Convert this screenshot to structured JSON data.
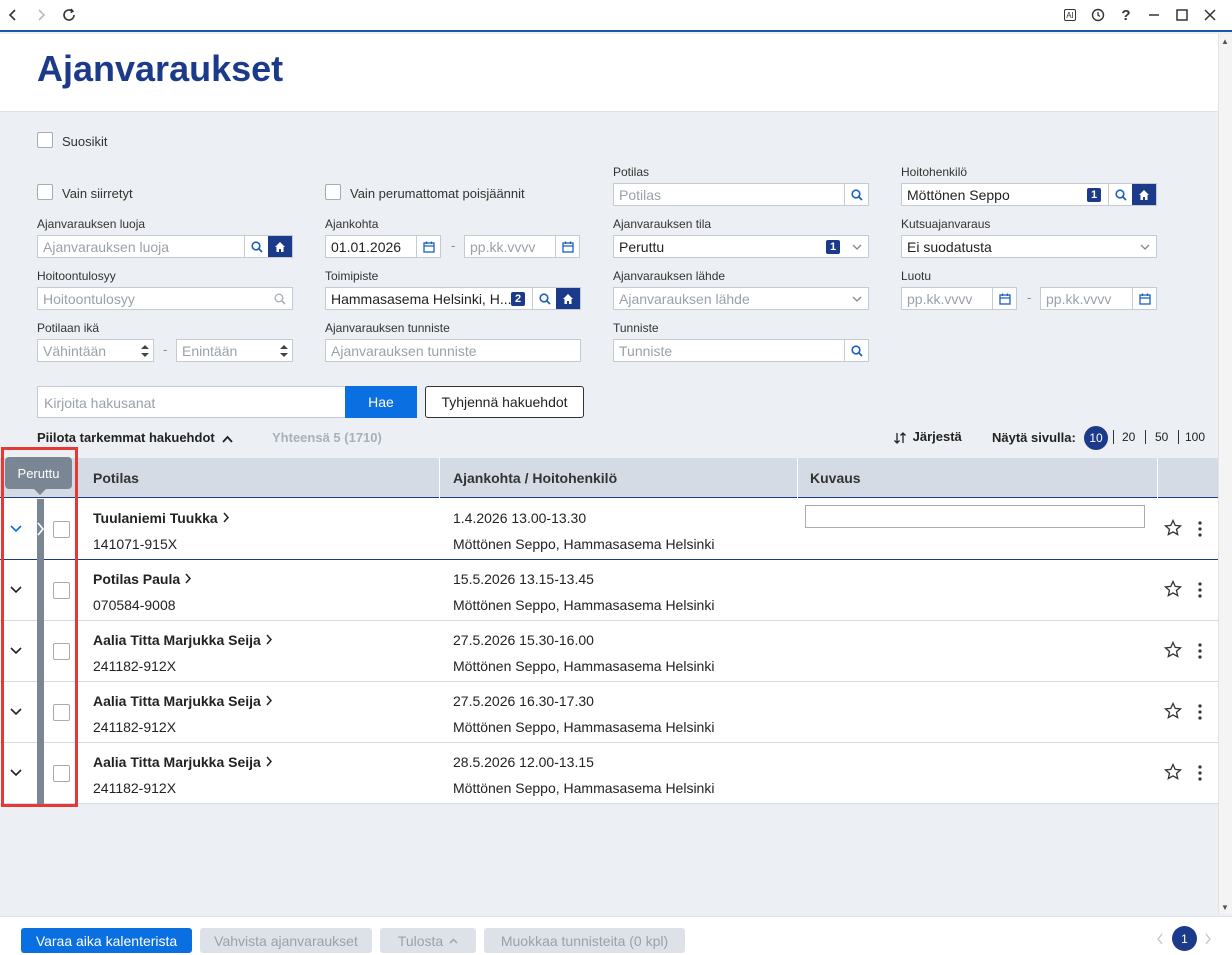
{
  "titlebar": {
    "ai_label": "AI",
    "help": "?"
  },
  "header": {
    "title": "Ajanvaraukset"
  },
  "filters": {
    "favorites_label": "Suosikit",
    "only_moved_label": "Vain siirretyt",
    "only_uncancelled_label": "Vain perumattomat poisjäännit",
    "patient": {
      "label": "Potilas",
      "placeholder": "Potilas"
    },
    "staff": {
      "label": "Hoitohenkilö",
      "value": "Möttönen Seppo",
      "badge": "1"
    },
    "creator": {
      "label": "Ajanvarauksen luoja",
      "placeholder": "Ajanvarauksen luoja"
    },
    "time": {
      "label": "Ajankohta",
      "from": "01.01.2026",
      "to_placeholder": "pp.kk.vvvv"
    },
    "status": {
      "label": "Ajanvarauksen tila",
      "value": "Peruttu",
      "badge": "1"
    },
    "invite": {
      "label": "Kutsuajanvaraus",
      "value": "Ei suodatusta"
    },
    "reason": {
      "label": "Hoitoontulosyy",
      "placeholder": "Hoitoontulosyy"
    },
    "office": {
      "label": "Toimipiste",
      "value": "Hammasasema Helsinki, H...",
      "badge": "2"
    },
    "source": {
      "label": "Ajanvarauksen lähde",
      "placeholder": "Ajanvarauksen lähde"
    },
    "created": {
      "label": "Luotu",
      "from_placeholder": "pp.kk.vvvv",
      "to_placeholder": "pp.kk.vvvv"
    },
    "age": {
      "label": "Potilaan ikä",
      "min_placeholder": "Vähintään",
      "max_placeholder": "Enintään"
    },
    "booking_id": {
      "label": "Ajanvarauksen tunniste",
      "placeholder": "Ajanvarauksen tunniste"
    },
    "identifier": {
      "label": "Tunniste",
      "placeholder": "Tunniste"
    },
    "dash": "-"
  },
  "search": {
    "placeholder": "Kirjoita hakusanat",
    "search_label": "Hae",
    "clear_label": "Tyhjennä hakuehdot"
  },
  "toolbar": {
    "hide_advanced": "Piilota tarkemmat hakuehdot",
    "total": "Yhteensä 5 (1710)",
    "sort": "Järjestä",
    "per_page_label": "Näytä sivulla:",
    "per_page_options": [
      "10",
      "20",
      "50",
      "100"
    ]
  },
  "table": {
    "columns": [
      "Potilas",
      "Ajankohta / Hoitohenkilö",
      "Kuvaus"
    ],
    "tooltip": "Peruttu",
    "rows": [
      {
        "name": "Tuulaniemi Tuukka",
        "id": "141071-915X",
        "time": "1.4.2026 13.00-13.30",
        "staff": "Möttönen Seppo, Hammasasema Helsinki"
      },
      {
        "name": "Potilas Paula",
        "id": "070584-9008",
        "time": "15.5.2026 13.15-13.45",
        "staff": "Möttönen Seppo, Hammasasema Helsinki"
      },
      {
        "name": "Aalia Titta Marjukka Seija",
        "id": "241182-912X",
        "time": "27.5.2026 15.30-16.00",
        "staff": "Möttönen Seppo, Hammasasema Helsinki"
      },
      {
        "name": "Aalia Titta Marjukka Seija",
        "id": "241182-912X",
        "time": "27.5.2026 16.30-17.30",
        "staff": "Möttönen Seppo, Hammasasema Helsinki"
      },
      {
        "name": "Aalia Titta Marjukka Seija",
        "id": "241182-912X",
        "time": "28.5.2026 12.00-13.15",
        "staff": "Möttönen Seppo, Hammasasema Helsinki"
      }
    ]
  },
  "footer": {
    "book_from_calendar": "Varaa aika kalenterista",
    "confirm": "Vahvista ajanvaraukset",
    "print": "Tulosta",
    "edit_ids": "Muokkaa tunnisteita (0 kpl)",
    "current_page": "1"
  },
  "colors": {
    "brand": "#1b3a8a",
    "primary": "#0a6fe0",
    "highlight": "#e53935",
    "status_cancelled": "#7b8694"
  }
}
